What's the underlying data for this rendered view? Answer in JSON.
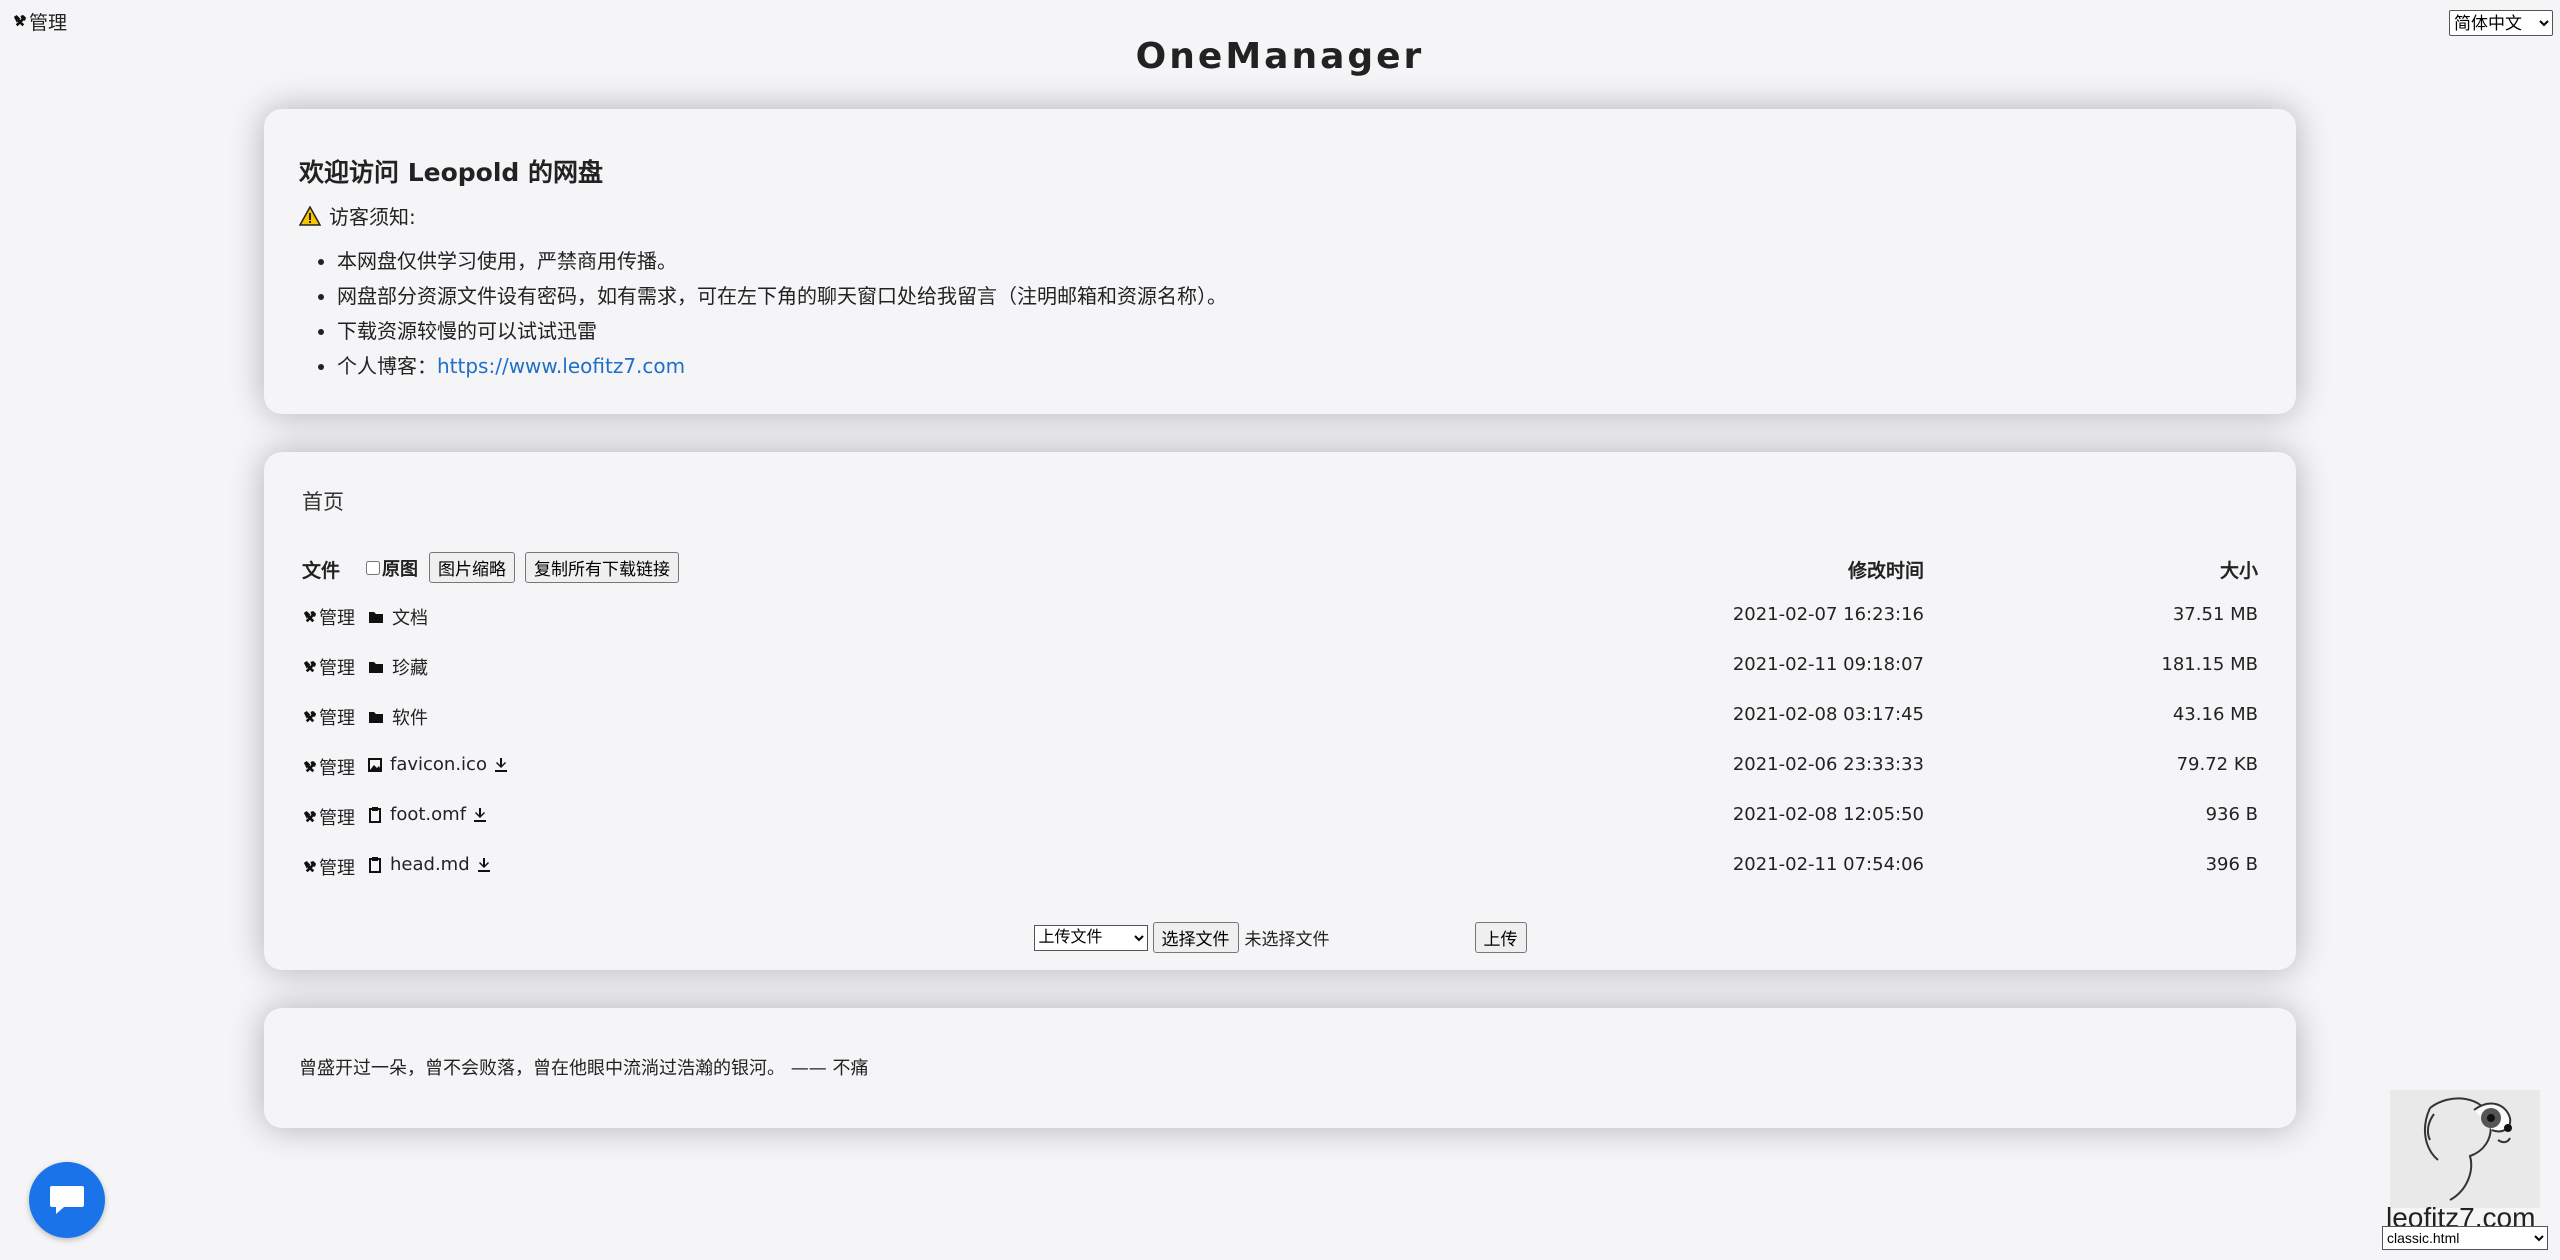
{
  "topbar": {
    "admin_label": "管理",
    "language": "简体中文"
  },
  "site_title": "OneManager",
  "head": {
    "title": "欢迎访问 Leopold 的网盘",
    "notice_label": "访客须知:",
    "items": [
      "本网盘仅供学习使用，严禁商用传播。",
      "网盘部分资源文件设有密码，如有需求，可在左下角的聊天窗口处给我留言（注明邮箱和资源名称）。",
      "下载资源较慢的可以试试迅雷"
    ],
    "blog_label": "个人博客：",
    "blog_link": "https://www.leofitz7.com"
  },
  "list": {
    "breadcrumb": "首页",
    "header": {
      "file": "文件",
      "original": "原图",
      "thumbnail_button": "图片缩略",
      "copy_links_button": "复制所有下载链接",
      "modified": "修改时间",
      "size": "大小"
    },
    "rows": [
      {
        "manage": "管理",
        "icon": "folder-icon",
        "name": "文档",
        "time": "2021-02-07 16:23:16",
        "size": "37.51 MB",
        "download": false
      },
      {
        "manage": "管理",
        "icon": "folder-icon",
        "name": "珍藏",
        "time": "2021-02-11 09:18:07",
        "size": "181.15 MB",
        "download": false
      },
      {
        "manage": "管理",
        "icon": "folder-icon",
        "name": "软件",
        "time": "2021-02-08 03:17:45",
        "size": "43.16 MB",
        "download": false
      },
      {
        "manage": "管理",
        "icon": "image-icon",
        "name": "favicon.ico",
        "time": "2021-02-06 23:33:33",
        "size": "79.72 KB",
        "download": true
      },
      {
        "manage": "管理",
        "icon": "file-icon",
        "name": "foot.omf",
        "time": "2021-02-08 12:05:50",
        "size": "936 B",
        "download": true
      },
      {
        "manage": "管理",
        "icon": "file-icon",
        "name": "head.md",
        "time": "2021-02-11 07:54:06",
        "size": "396 B",
        "download": true
      }
    ],
    "upload": {
      "mode": "上传文件",
      "choose_button": "选择文件",
      "status": "未选择文件",
      "submit_button": "上传"
    }
  },
  "footer": {
    "quote": "曾盛开过一朵，曾不会败落，曾在他眼中流淌过浩瀚的银河。 —— 不痛"
  },
  "widgets": {
    "mascot_label": "leofitz7.com",
    "theme": "classic.html"
  },
  "colors": {
    "background": "#f5f5f7",
    "link": "#1f6fc7",
    "chat": "#1a73e8"
  }
}
